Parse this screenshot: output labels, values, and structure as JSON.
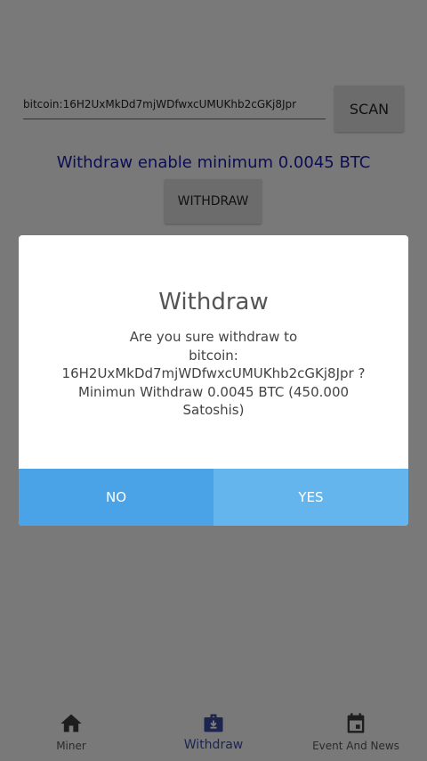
{
  "address": {
    "value": "bitcoin:16H2UxMkDd7mjWDfwxcUMUKhb2cGKj8Jpr"
  },
  "scan_label": "SCAN",
  "min_text": "Withdraw enable minimum 0.0045 BTC",
  "withdraw_button_label": "WITHDRAW",
  "dialog": {
    "title": "Withdraw",
    "line1": "Are you sure withdraw to",
    "line2": "bitcoin:",
    "line3": "16H2UxMkDd7mjWDfwxcUMUKhb2cGKj8Jpr ?",
    "line4": "Minimun Withdraw 0.0045 BTC (450.000",
    "line5": "Satoshis)",
    "no_label": "NO",
    "yes_label": "YES"
  },
  "nav": {
    "items": [
      {
        "label": "Miner",
        "icon": "home-icon"
      },
      {
        "label": "Withdraw",
        "icon": "wallet-icon",
        "active": true
      },
      {
        "label": "Event And News",
        "icon": "calendar-icon"
      }
    ]
  },
  "colors": {
    "accent_blue": "#3a4a9e",
    "min_text": "#1a1aa8",
    "no_button": "#4aa3e6",
    "yes_button": "#64b5ee"
  }
}
